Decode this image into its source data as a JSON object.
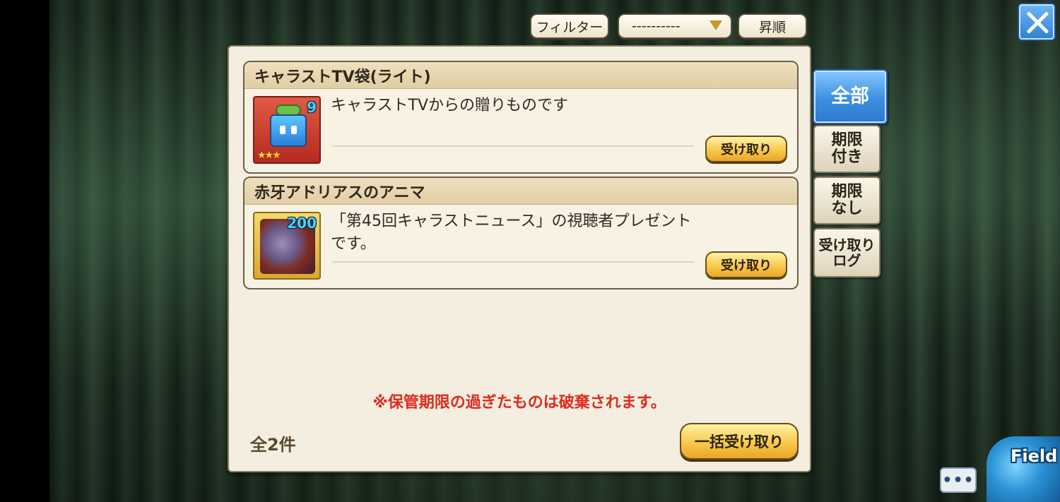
{
  "toolbar": {
    "filter_label": "フィルター",
    "filter_value": "----------",
    "sort_label": "昇順"
  },
  "items": [
    {
      "title": "キャラストTV袋(ライト)",
      "description": "キャラストTVからの贈りものです",
      "quantity": "9",
      "rarity": "★★★",
      "icon": "gift-cube-icon",
      "button": "受け取り"
    },
    {
      "title": "赤牙アドリアスのアニマ",
      "description": "「第45回キャラストニュース」の視聴者プレゼントです。",
      "quantity": "200",
      "icon": "anima-portrait-icon",
      "button": "受け取り"
    }
  ],
  "notice": "※保管期限の過ぎたものは破棄されます。",
  "count_label": "全2件",
  "bulk_receive_label": "一括受け取り",
  "tabs": [
    {
      "label": "全部",
      "active": true
    },
    {
      "label": "期限\n付き",
      "active": false
    },
    {
      "label": "期限\nなし",
      "active": false
    },
    {
      "label": "受け取り\nログ",
      "active": false
    }
  ],
  "chat_label": "•••",
  "field_label": "Field",
  "colors": {
    "accent_blue": "#3b8fe0",
    "button_gold": "#f9c94a",
    "warning_red": "#e02a1e",
    "panel_bg": "#f3eedf"
  }
}
